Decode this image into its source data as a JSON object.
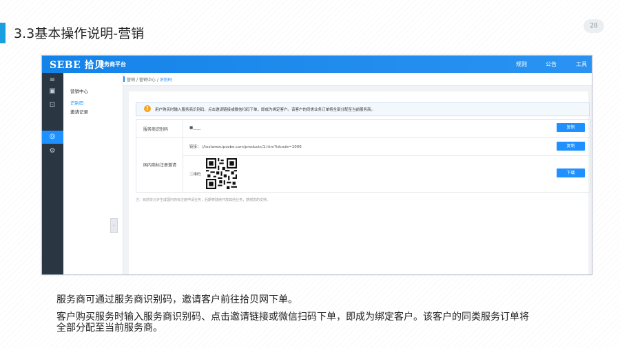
{
  "slide": {
    "title": "3.3基本操作说明-营销",
    "page_number": "28",
    "accent_color": "#1a9ee0",
    "caption_line1": "服务商可通过服务商识别码，邀请客户前往拾贝网下单。",
    "caption_line2": "客户购买服务时输入服务商识别码、点击邀请链接或微信扫码下单，即成为绑定客户。该客户的同类服务订单将",
    "caption_line3": "全部分配至当前服务商。"
  },
  "app": {
    "logo": "SEBE 拾贝",
    "platform_name": "服务商平台",
    "brand_color": "#1e90ff",
    "nav": [
      "规则",
      "公告",
      "工具"
    ],
    "sidebar_icons": [
      "menu-icon",
      "calendar-icon",
      "briefcase-icon",
      "marketing-icon",
      "settings-icon"
    ],
    "submenu": {
      "heading": "营销中心",
      "items": [
        "识别码",
        "邀请记录"
      ],
      "active_item": "识别码"
    },
    "breadcrumb": {
      "level1": "营销",
      "sep": "/",
      "level2": "营销中心",
      "current": "识别码"
    },
    "notice": "用户购买时输入服务商识别码、点击邀请链接或微信扫码下单，即成为绑定客户。该客户的同类业务订单将全部分配至当前服务商。",
    "code_row": {
      "label": "服务商识别码",
      "value": "■____",
      "button": "复制"
    },
    "invite": {
      "label": "国内商标注册邀请",
      "link_label": "链接：",
      "link_value": "//testwww.ipsebe.com/products/1.htm?idcode=1006",
      "link_button": "复制",
      "qr_label": "二维码",
      "qr_button": "下载"
    },
    "note": "注：目前仅允许生成国内商标注册申请业务，后期将陆续开放其他业务，感谢您的支持。"
  }
}
